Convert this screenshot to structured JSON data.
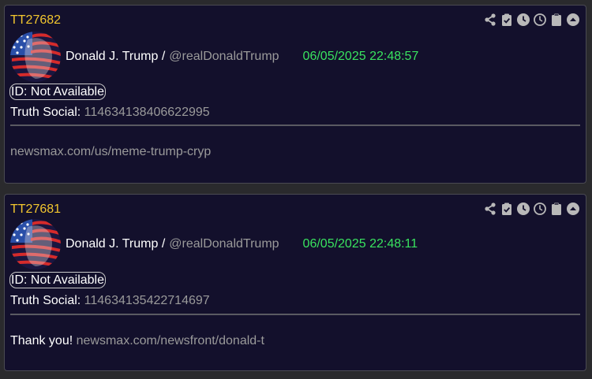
{
  "posts": [
    {
      "id": "TT27682",
      "author_name": "Donald J. Trump /",
      "author_handle": "@realDonaldTrump",
      "datetime": "06/05/2025 22:48:57",
      "id_badge": "ID: Not Available",
      "social_label": "Truth Social:",
      "social_id": "114634138406622995",
      "body_text": "",
      "body_link": "newsmax.com/us/meme-trump-cryp"
    },
    {
      "id": "TT27681",
      "author_name": "Donald J. Trump /",
      "author_handle": "@realDonaldTrump",
      "datetime": "06/05/2025 22:48:11",
      "id_badge": "ID: Not Available",
      "social_label": "Truth Social:",
      "social_id": "114634135422714697",
      "body_text": "Thank you!",
      "body_link": "newsmax.com/newsfront/donald-t"
    }
  ],
  "icons": [
    "share-icon",
    "clipboard-check-icon",
    "clock-filled-icon",
    "clock-outline-icon",
    "clipboard-icon",
    "chevron-up-circle-icon"
  ],
  "colors": {
    "background": "#2a2a2d",
    "card": "#13102c",
    "post_id": "#f2c62e",
    "datetime": "#39e35f",
    "muted": "#9a9a9a",
    "icon": "#b9b9b9"
  }
}
